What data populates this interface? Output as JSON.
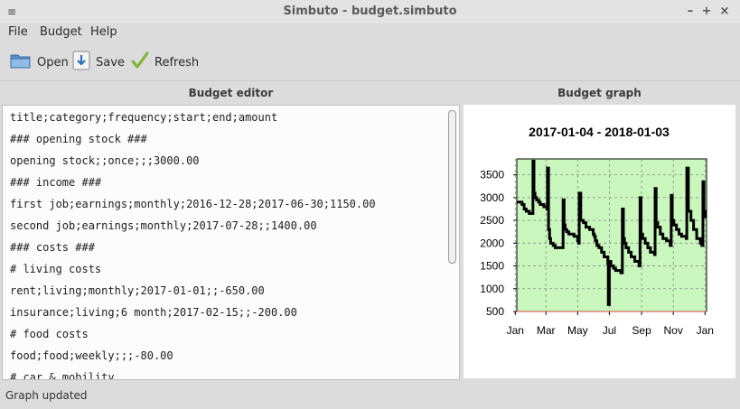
{
  "window": {
    "title": "Simbuto - budget.simbuto",
    "app_menu": "≡",
    "minimize": "–",
    "maximize": "+",
    "close": "×"
  },
  "menu": [
    "File",
    "Budget",
    "Help"
  ],
  "toolbar": {
    "open_label": "Open",
    "save_label": "Save",
    "refresh_label": "Refresh"
  },
  "editor": {
    "header": "Budget editor",
    "lines": [
      "title;category;frequency;start;end;amount",
      "### opening stock ###",
      "opening stock;;once;;;3000.00",
      "### income ###",
      "first job;earnings;monthly;2016-12-28;2017-06-30;1150.00",
      "second job;earnings;monthly;2017-07-28;;1400.00",
      "### costs ###",
      "# living costs",
      "rent;living;monthly;2017-01-01;;-650.00",
      "insurance;living;6 month;2017-02-15;;-200.00",
      "# food costs",
      "food;food;weekly;;;-80.00",
      "# car & mobility"
    ]
  },
  "graph": {
    "header": "Budget graph"
  },
  "chart_data": {
    "type": "line",
    "title": "2017-01-04  -  2018-01-03",
    "xlabel": "",
    "ylabel": "",
    "x_ticks": [
      "Jan",
      "Mar",
      "May",
      "Jul",
      "Sep",
      "Nov",
      "Jan"
    ],
    "y_ticks": [
      500,
      1000,
      1500,
      2000,
      2500,
      3000,
      3500
    ],
    "ylim": [
      500,
      3850
    ],
    "xlim": [
      0,
      365
    ],
    "grid": true,
    "background": "#c9f7bd",
    "line_color": "#000000",
    "series": [
      {
        "x": [
          0,
          10,
          14,
          18,
          24,
          30,
          31,
          33,
          35,
          38,
          42,
          45,
          52,
          58,
          59,
          61,
          63,
          65,
          70,
          74,
          80,
          87,
          89,
          91,
          93,
          96,
          100,
          105,
          110,
          117,
          119,
          120,
          123,
          128,
          133,
          140,
          147,
          149,
          151,
          154,
          158,
          163,
          168,
          175,
          176,
          178,
          181,
          186,
          190,
          200,
          203,
          205,
          207,
          210,
          215,
          220,
          227,
          235,
          237,
          239,
          242,
          247,
          252,
          257,
          265,
          266,
          268,
          271,
          276,
          281,
          288,
          295,
          297,
          299,
          302,
          307,
          312,
          317,
          326,
          327,
          330,
          335,
          340,
          346,
          353,
          356,
          358,
          360,
          363
        ],
        "y": [
          2900,
          2850,
          2750,
          2700,
          2650,
          2650,
          3800,
          3100,
          3000,
          2950,
          2900,
          2850,
          2800,
          2750,
          3650,
          2300,
          2100,
          2000,
          1950,
          1900,
          1900,
          1900,
          2950,
          2400,
          2300,
          2250,
          2200,
          2200,
          2150,
          2050,
          2000,
          3100,
          2500,
          2450,
          2350,
          2300,
          2200,
          2150,
          2050,
          1950,
          1900,
          1800,
          1700,
          1550,
          650,
          1600,
          1500,
          1450,
          1400,
          1350,
          2750,
          2100,
          2000,
          1900,
          1800,
          1700,
          1600,
          1500,
          3000,
          2200,
          2100,
          2000,
          1900,
          1800,
          1750,
          3200,
          2450,
          2350,
          2200,
          2100,
          2050,
          1950,
          3050,
          2500,
          2400,
          2300,
          2200,
          2150,
          2100,
          3650,
          2700,
          2500,
          2300,
          2100,
          2000,
          1950,
          3350,
          2700,
          2550
        ]
      }
    ]
  },
  "status": {
    "text": "Graph updated"
  }
}
